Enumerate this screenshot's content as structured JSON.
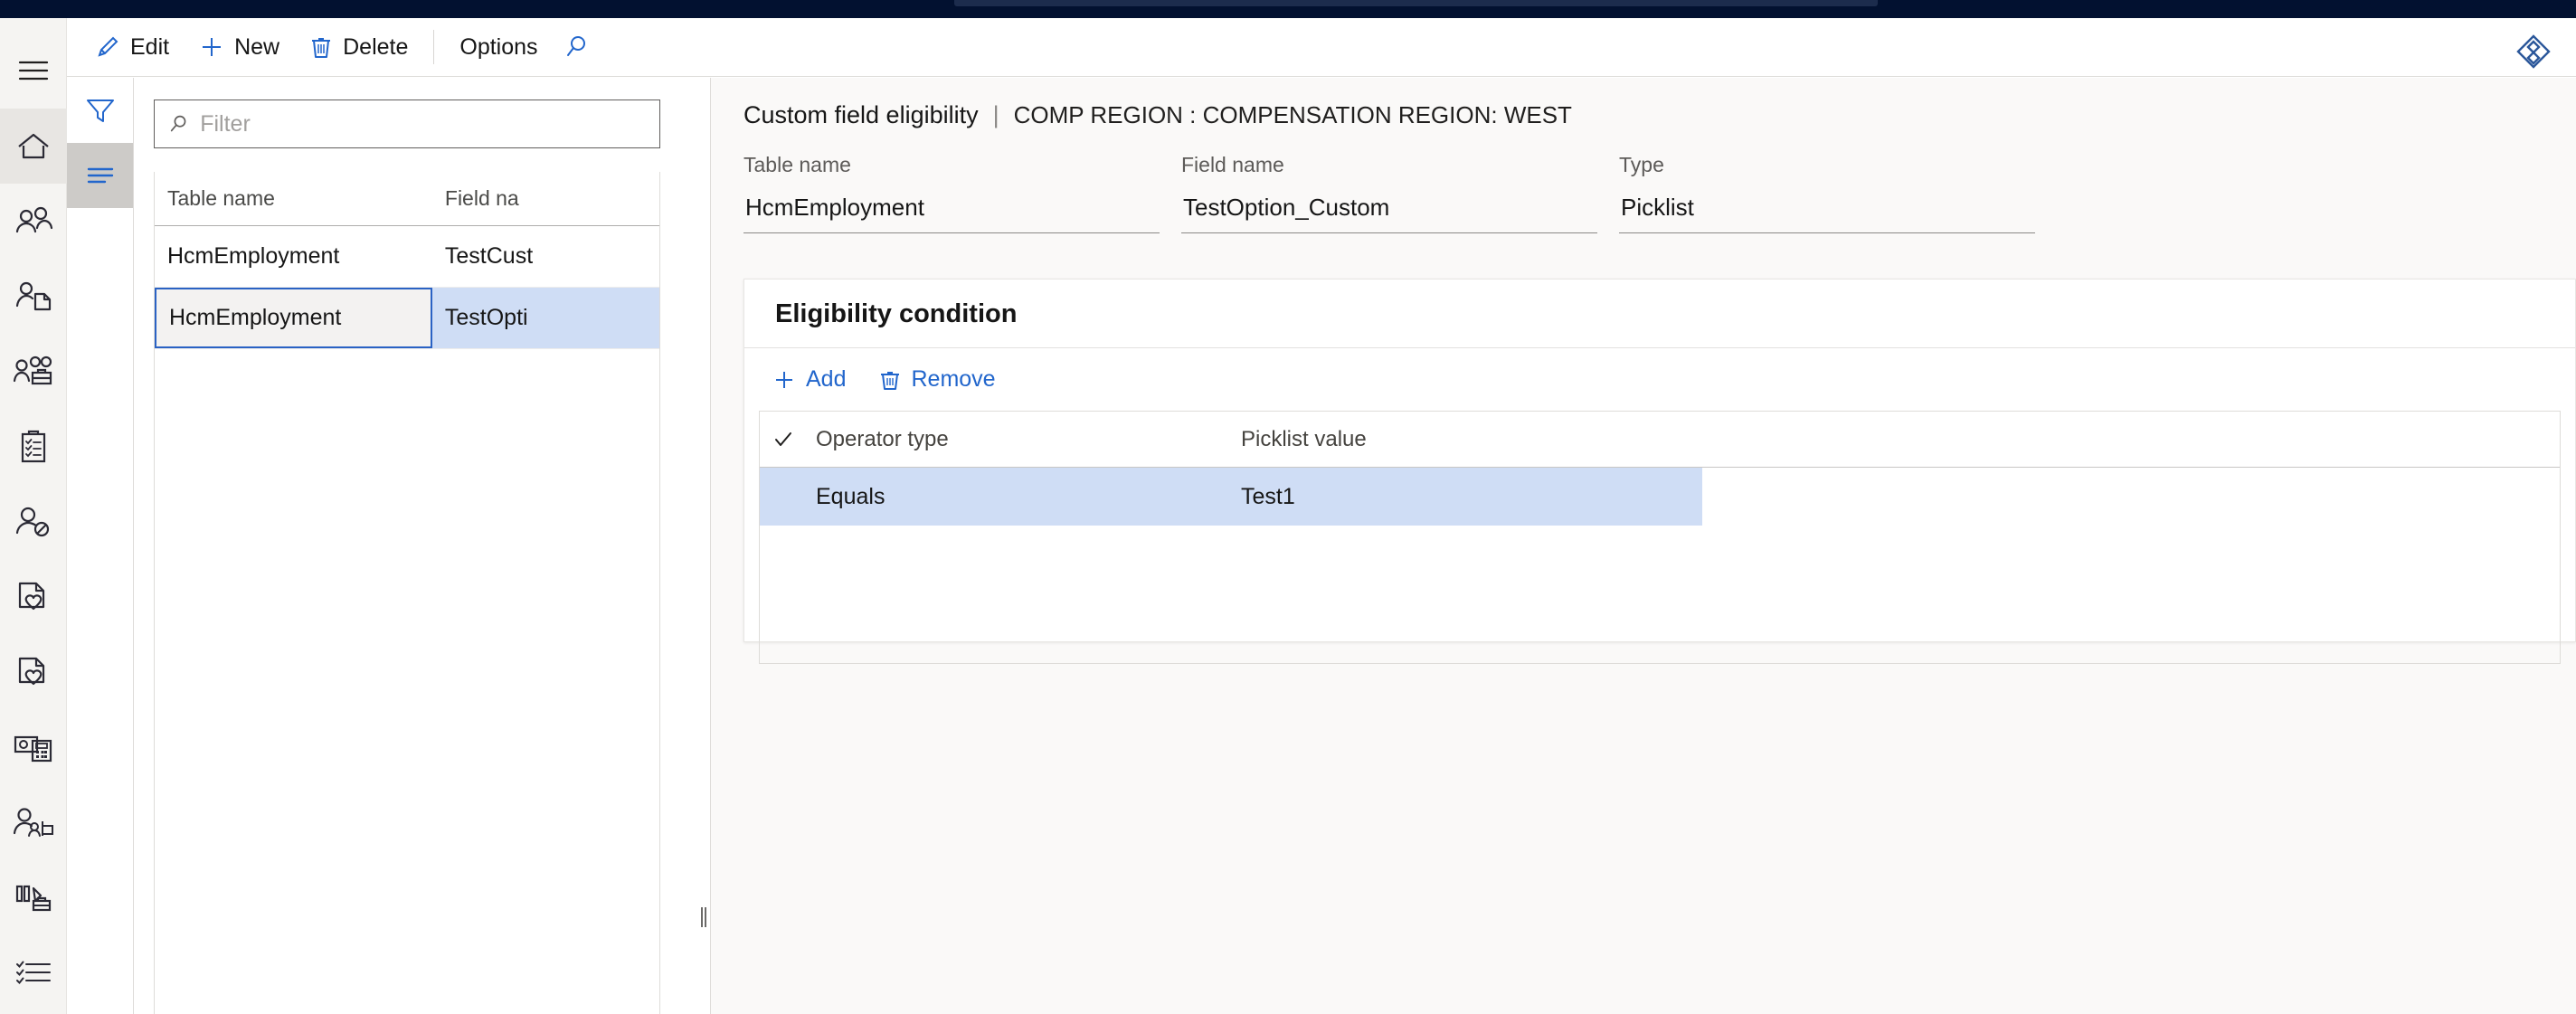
{
  "window": {
    "accent_navy": "#021130",
    "accent_blue": "#2266cc",
    "selection_blue": "#cfddf5"
  },
  "rail": {
    "menu_icon": "hamburger-menu-icon",
    "items": [
      {
        "id": "home",
        "icon": "home-icon",
        "active": true
      },
      {
        "id": "people",
        "icon": "people-icon",
        "active": false
      },
      {
        "id": "person-document",
        "icon": "person-document-icon",
        "active": false
      },
      {
        "id": "workforce",
        "icon": "people-briefcase-icon",
        "active": false
      },
      {
        "id": "clipboard-tasks",
        "icon": "clipboard-checklist-icon",
        "active": false
      },
      {
        "id": "person-blocked",
        "icon": "person-blocked-icon",
        "active": false
      },
      {
        "id": "benefits-1",
        "icon": "document-heart-icon",
        "active": false
      },
      {
        "id": "benefits-2",
        "icon": "document-heart-icon",
        "active": false
      },
      {
        "id": "payroll",
        "icon": "money-calculator-icon",
        "active": false
      },
      {
        "id": "recruiting",
        "icon": "person-team-icon",
        "active": false
      },
      {
        "id": "analytics",
        "icon": "chart-briefcase-icon",
        "active": false
      },
      {
        "id": "lists",
        "icon": "checklist-lines-icon",
        "active": false
      }
    ]
  },
  "commandbar": {
    "buttons": [
      {
        "label": "Edit",
        "icon": "pencil-icon"
      },
      {
        "label": "New",
        "icon": "plus-icon"
      },
      {
        "label": "Delete",
        "icon": "trash-icon"
      }
    ],
    "options_label": "Options",
    "search_icon": "search-icon",
    "brand_icon": "diamond-logo-icon"
  },
  "vtabs": [
    {
      "id": "filter-pane",
      "icon": "funnel-icon",
      "active": false
    },
    {
      "id": "list-pane",
      "icon": "list-lines-icon",
      "active": true
    }
  ],
  "list_panel": {
    "filter": {
      "placeholder": "Filter",
      "value": "",
      "icon": "search-icon"
    },
    "columns": [
      "Table name",
      "Field na"
    ],
    "rows": [
      {
        "table_name": "HcmEmployment",
        "field_name": "TestCust",
        "selected": false
      },
      {
        "table_name": "HcmEmployment",
        "field_name": "TestOpti",
        "selected": true
      }
    ]
  },
  "main": {
    "header": {
      "title": "Custom field eligibility",
      "separator": "|",
      "subtitle": "COMP REGION : COMPENSATION REGION: WEST"
    },
    "fields": [
      {
        "label": "Table name",
        "value": "HcmEmployment"
      },
      {
        "label": "Field name",
        "value": "TestOption_Custom"
      },
      {
        "label": "Type",
        "value": "Picklist"
      }
    ],
    "card": {
      "title": "Eligibility condition",
      "toolbar": [
        {
          "label": "Add",
          "icon": "plus-icon"
        },
        {
          "label": "Remove",
          "icon": "trash-icon"
        }
      ],
      "grid": {
        "check_icon": "checkmark-icon",
        "columns": [
          "Operator type",
          "Picklist value"
        ],
        "rows": [
          {
            "operator_type": "Equals",
            "picklist_value": "Test1",
            "selected": true
          }
        ]
      }
    }
  }
}
